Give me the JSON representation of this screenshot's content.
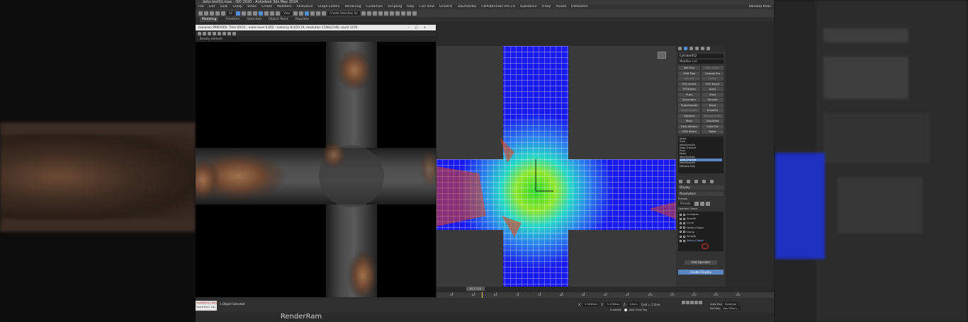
{
  "window": {
    "title": "data test01.max - ISO 2020 - Autodesk 3ds Max 2024",
    "menus": [
      "File",
      "Edit",
      "Tools",
      "Group",
      "Views",
      "Create",
      "Modifiers",
      "Animation",
      "Graph Editors",
      "Rendering",
      "Customize",
      "Scripting",
      "Help",
      "Civil View",
      "Ornatrix",
      "3DGROUND",
      "FilePathFinder Pro v.4",
      "Substance",
      "V-Ray",
      "Arnold",
      "UVReactor"
    ],
    "user": "Vanessa Kirov"
  },
  "toolbar": {
    "view_dropdown": "View",
    "selection_set": "Create Selection Se"
  },
  "ribbon": {
    "tabs": [
      "Modeling",
      "Freeform",
      "Selection",
      "Object Paint",
      "Populate"
    ]
  },
  "render_frame": {
    "title": "Ivanasen 999/1000, Time 00:01 : noise level 0.002 : memory 8.0/20.19, resolution 1148x1148, count 1476",
    "channel": "Beauty element"
  },
  "command_panel": {
    "object_name": "Cylinder012",
    "modifier_list": "Modifier List",
    "modifier_buttons": [
      [
        "Edit Poly",
        "Edit Spline"
      ],
      [
        "UVW Map",
        "Unwrap Pro"
      ],
      [
        "Extrude",
        "Lathe"
      ],
      [
        "FFD 3x3x3",
        "FFD 3x3x3"
      ],
      [
        "TFFD(box)",
        "Array"
      ],
      [
        "Push",
        "Shell"
      ],
      [
        "Symmetry",
        "Smooth"
      ],
      [
        "TurboSmooth",
        "Bend"
      ],
      [
        "MeshSmooth",
        "Chamfer"
      ],
      [
        "Displace",
        "Tension Scale"
      ],
      [
        "Relax",
        "Subdivide"
      ],
      [
        "Path Deform",
        "Cloth Pro"
      ],
      [
        "UVW Xform",
        "Noise"
      ]
    ],
    "dim_buttons": [
      "Edit Spline",
      "Extrude",
      "Lathe",
      "MeshSmooth",
      "Tension Scale"
    ],
    "stack": [
      "Noise",
      "Push",
      "MeshSmooth",
      "Data Channel",
      "Push",
      "Noise",
      "MeshSmooth",
      "Data Channel",
      "MeshSmooth",
      "Editable Poly"
    ],
    "stack_selected_index": 7,
    "rollouts": {
      "display": "Display",
      "parameters": "Parameters"
    },
    "presets_label": "Presets",
    "presets_value": "Presets",
    "operator_stack_label": "Operator Stack",
    "operators": [
      "Curvature",
      "Smooth",
      "Curve",
      "Vertex Output",
      "Clamp",
      "Smooth",
      "Vertex Output"
    ],
    "operator_selected_index": 6,
    "add_operator": "Add Operator",
    "enable_display": "Enable Display"
  },
  "timeline": {
    "frame": "62 / 120",
    "ticks": [
      "55",
      "60",
      "65",
      "70",
      "75",
      "80",
      "85",
      "90",
      "95",
      "100",
      "105",
      "110",
      "115",
      "120"
    ]
  },
  "status": {
    "mini_listener_1": "modifiers1.net(t)",
    "mini_listener_2": "NoiseTest1.3ds",
    "selected": "1 Object Selected",
    "x_label": "X:",
    "x_value": "2.5240cm",
    "y_label": "Y:",
    "y_value": "3.1740cm",
    "z_label": "Z:",
    "z_value": "0.0cm",
    "grid": "Grid = 1.0cm",
    "enabled": "Enabled:",
    "add_time_tag": "Add Time Tag",
    "auto_key": "Auto Key",
    "selected_dropdown": "Selected",
    "set_key": "Set Key",
    "key_filters": "Key Filters..."
  },
  "watermark": "RenderRam",
  "colors": {
    "accent": "#5a86c4",
    "heat_center": "#3ad23a",
    "heat_edge": "#1a1aff",
    "mesh_hot": "#e0451a"
  }
}
